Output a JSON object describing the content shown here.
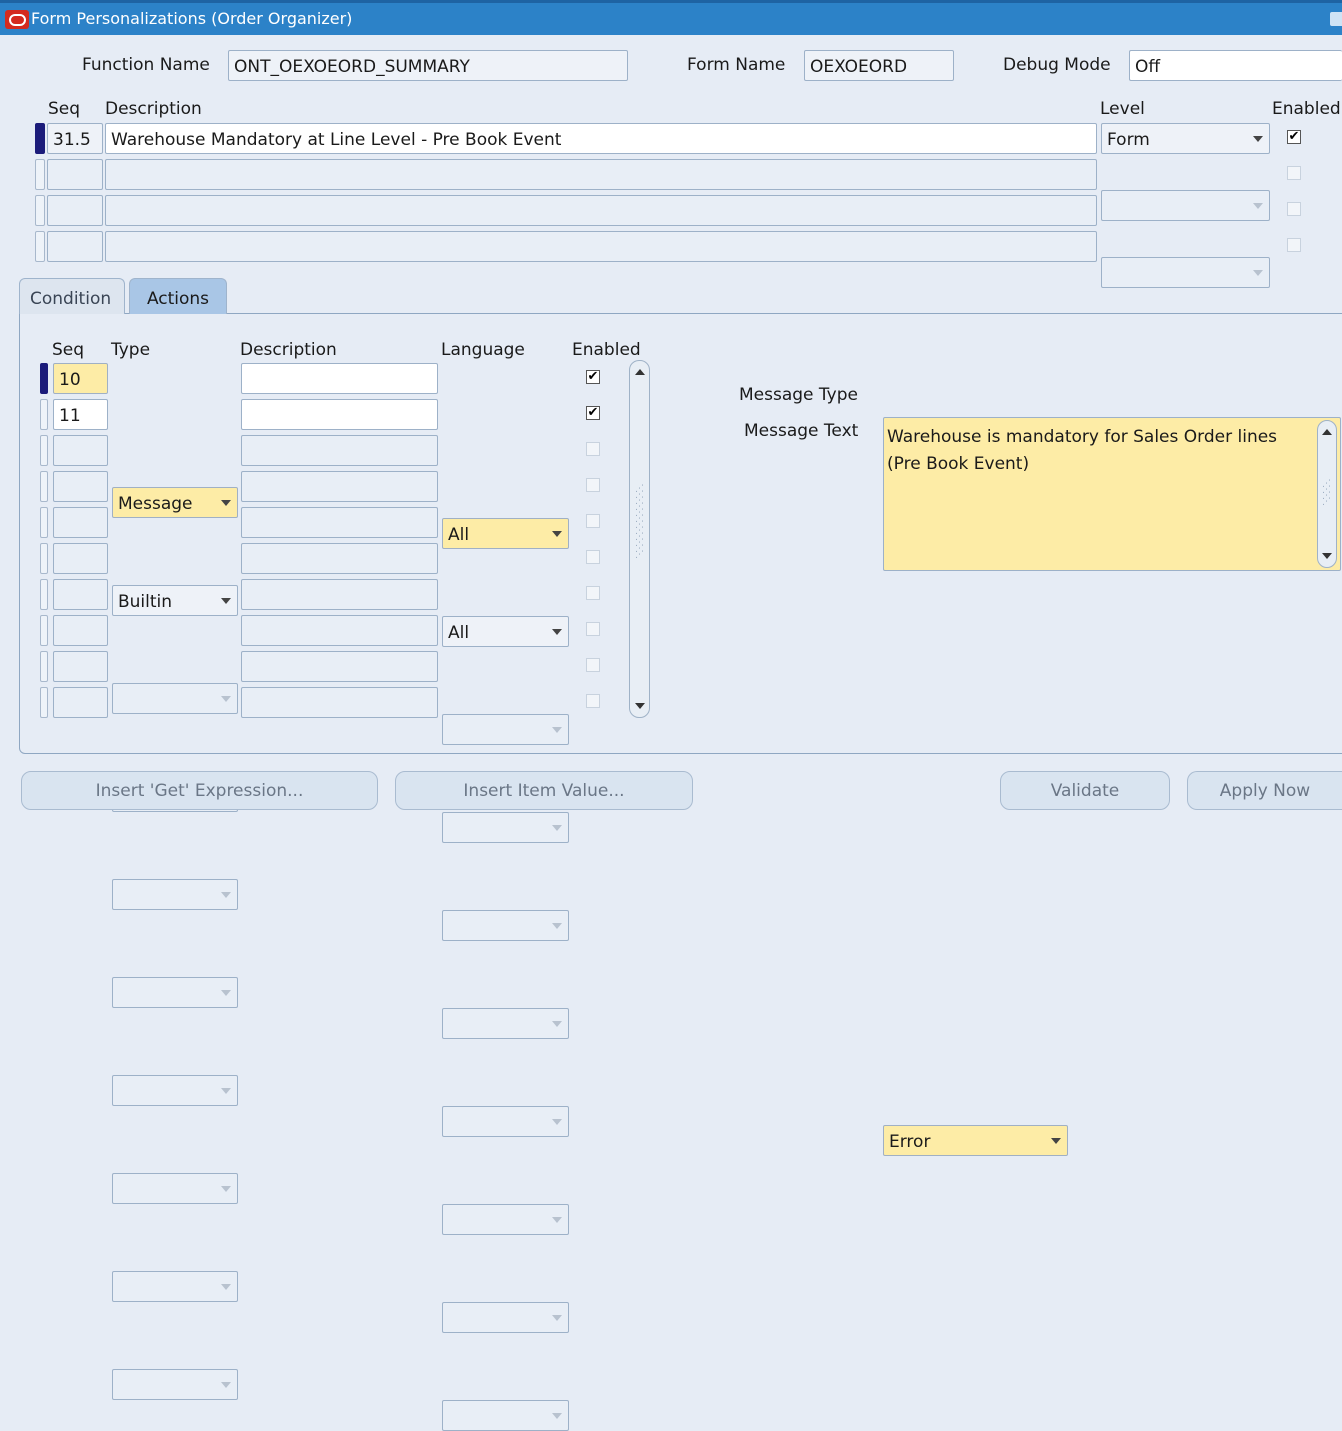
{
  "window": {
    "title": "Form Personalizations (Order Organizer)"
  },
  "header": {
    "function_name_label": "Function Name",
    "function_name_value": "ONT_OEXOEORD_SUMMARY",
    "form_name_label": "Form Name",
    "form_name_value": "OEXOEORD",
    "debug_mode_label": "Debug Mode",
    "debug_mode_value": "Off"
  },
  "rules": {
    "columns": {
      "seq": "Seq",
      "description": "Description",
      "level": "Level",
      "enabled": "Enabled"
    },
    "rows": [
      {
        "seq": "31.5",
        "description": "Warehouse Mandatory at Line Level - Pre Book Event",
        "level": "Form",
        "enabled": true
      },
      {
        "seq": "",
        "description": "",
        "level": "",
        "enabled": false
      },
      {
        "seq": "",
        "description": "",
        "level": "",
        "enabled": false
      },
      {
        "seq": "",
        "description": "",
        "level": "",
        "enabled": false
      }
    ]
  },
  "tabs": [
    {
      "label": "Condition",
      "active": false
    },
    {
      "label": "Actions",
      "active": true
    }
  ],
  "actions": {
    "columns": {
      "seq": "Seq",
      "type": "Type",
      "description": "Description",
      "language": "Language",
      "enabled": "Enabled"
    },
    "rows": [
      {
        "seq": "10",
        "type": "Message",
        "description": "",
        "language": "All",
        "enabled": true
      },
      {
        "seq": "11",
        "type": "Builtin",
        "description": "",
        "language": "All",
        "enabled": true
      },
      {
        "seq": "",
        "type": "",
        "description": "",
        "language": "",
        "enabled": false
      },
      {
        "seq": "",
        "type": "",
        "description": "",
        "language": "",
        "enabled": false
      },
      {
        "seq": "",
        "type": "",
        "description": "",
        "language": "",
        "enabled": false
      },
      {
        "seq": "",
        "type": "",
        "description": "",
        "language": "",
        "enabled": false
      },
      {
        "seq": "",
        "type": "",
        "description": "",
        "language": "",
        "enabled": false
      },
      {
        "seq": "",
        "type": "",
        "description": "",
        "language": "",
        "enabled": false
      },
      {
        "seq": "",
        "type": "",
        "description": "",
        "language": "",
        "enabled": false
      },
      {
        "seq": "",
        "type": "",
        "description": "",
        "language": "",
        "enabled": false
      }
    ]
  },
  "message": {
    "type_label": "Message Type",
    "type_value": "Error",
    "text_label": "Message Text",
    "text_line1": "Warehouse is mandatory for Sales Order lines",
    "text_line2": "(Pre Book Event)"
  },
  "buttons": {
    "insert_get": "Insert 'Get' Expression...",
    "insert_item": "Insert Item Value...",
    "validate": "Validate",
    "apply_now": "Apply Now"
  },
  "colors": {
    "titlebar": "#2c82c8",
    "active_marker": "#1b1b7a",
    "highlight_field": "#fdeca6"
  }
}
